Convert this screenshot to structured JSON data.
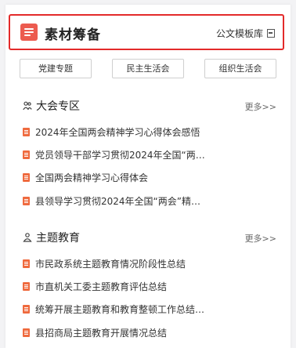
{
  "header": {
    "title": "素材筹备",
    "right_link": "公文模板库",
    "icons": [
      "logo-icon",
      "book-icon"
    ],
    "accent_color": "#e32a2a"
  },
  "tabs": [
    "党建专题",
    "民主生活会",
    "组织生活会"
  ],
  "sections": [
    {
      "title": "大会专区",
      "more": "更多>>",
      "icon": "people-icon",
      "items": [
        "2024年全国两会精神学习心得体会感悟",
        "党员领导干部学习贯彻2024年全国“两…",
        "全国两会精神学习心得体会",
        "县领导学习贯彻2024年全国“两会”精…"
      ]
    },
    {
      "title": "主题教育",
      "more": "更多>>",
      "icon": "person-icon",
      "items": [
        "市民政系统主题教育情况阶段性总结",
        "市直机关工委主题教育评估总结",
        "统筹开展主题教育和教育整顿工作总结…",
        "县招商局主题教育开展情况总结"
      ]
    }
  ]
}
